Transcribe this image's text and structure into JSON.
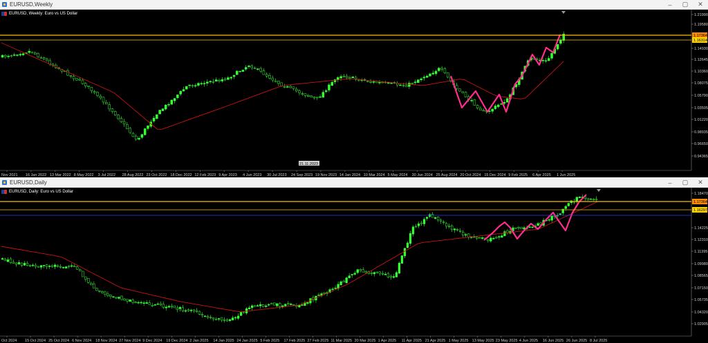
{
  "weekly": {
    "window_title": "EURUSD,Weekly",
    "symbol_label": "EURUSD, Weekly:  Euro vs US Dollar",
    "price_labels": [
      "1.21990",
      "1.19580",
      "1.17364",
      "1.16314",
      "1.14930",
      "1.12645",
      "1.10360",
      "1.08075",
      "1.05790",
      "1.03505",
      "1.01220",
      "0.98935",
      "0.96650",
      "0.94365"
    ],
    "current_price": "1.17364",
    "level_price": "1.16314",
    "time_labels": [
      "Nov 2021",
      "16 Jan 2022",
      "13 Mar 2022",
      "8 May 2022",
      "3 Jul 2022",
      "28 Aug 2022",
      "23 Oct 2022",
      "18 Dec 2022",
      "12 Feb 2023",
      "9 Apr 2023",
      "4 Jun 2023",
      "30 Jul 2023",
      "24 Sep 2023",
      "19 Nov 2023",
      "14 Jan 2024",
      "10 Mar 2024",
      "5 May 2024",
      "30 Jun 2024",
      "25 Aug 2024",
      "20 Oct 2024",
      "15 Dec 2024",
      "9 Feb 2025",
      "6 Apr 2025",
      "1 Jun 2025"
    ],
    "crosshair_date": "21.11.2023",
    "crosshair_time": "20:30"
  },
  "daily": {
    "window_title": "EURUSD,Daily",
    "symbol_label": "EURUSD, Daily:  Euro vs US Dollar",
    "price_labels": [
      "1.18470",
      "1.17364",
      "1.16297",
      "1.14225",
      "1.12310",
      "1.11395",
      "1.09980",
      "1.08565",
      "1.07150",
      "1.05735",
      "1.04320",
      "1.02905"
    ],
    "current_price": "1.17364",
    "level_price": "1.16297",
    "time_labels": [
      "Oct 2024",
      "15 Oct 2024",
      "25 Oct 2024",
      "6 Nov 2024",
      "18 Nov 2024",
      "27 Nov 2024",
      "9 Dec 2024",
      "19 Dec 2024",
      "2 Jan 2025",
      "14 Jan 2025",
      "24 Jan 2025",
      "5 Feb 2025",
      "17 Feb 2025",
      "27 Feb 2025",
      "11 Mar 2025",
      "20 Mar 2025",
      "1 Apr 2025",
      "11 Apr 2025",
      "21 Apr 2025",
      "1 May 2025",
      "13 May 2025",
      "23 May 2025",
      "4 Jun 2025",
      "16 Jun 2025",
      "26 Jun 2025",
      "8 Jul 2025"
    ]
  },
  "colors": {
    "candle": "#33ff33",
    "moving_average": "#c81414",
    "zigzag": "#ff2d8c",
    "level_line": "#ffc000",
    "current_price_bg": "#ff8c00",
    "level_bg": "#ffd400"
  },
  "window_controls": {
    "minimize": "–",
    "maximize": "▢",
    "close": "✕"
  }
}
